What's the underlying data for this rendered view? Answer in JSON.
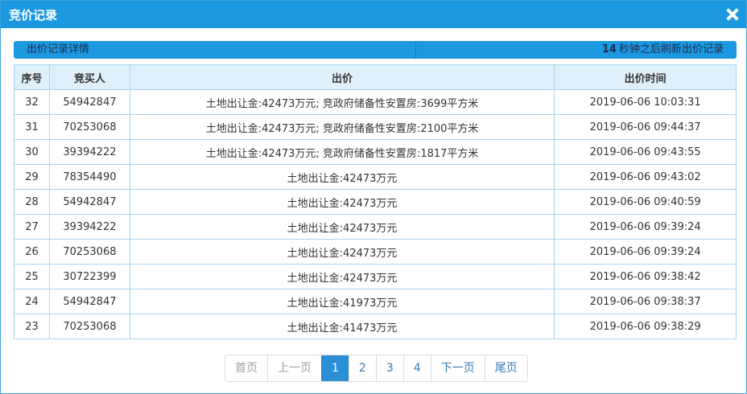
{
  "dialog": {
    "title": "竞价记录"
  },
  "infobar": {
    "left_label": "出价记录详情",
    "refresh_seconds": "14",
    "refresh_suffix": "秒钟之后刷新出价记录"
  },
  "table": {
    "headers": [
      "序号",
      "竞买人",
      "出价",
      "出价时间"
    ],
    "rows": [
      [
        "32",
        "54942847",
        "土地出让金:42473万元; 竞政府储备性安置房:3699平方米",
        "2019-06-06 10:03:31"
      ],
      [
        "31",
        "70253068",
        "土地出让金:42473万元; 竞政府储备性安置房:2100平方米",
        "2019-06-06 09:44:37"
      ],
      [
        "30",
        "39394222",
        "土地出让金:42473万元; 竞政府储备性安置房:1817平方米",
        "2019-06-06 09:43:55"
      ],
      [
        "29",
        "78354490",
        "土地出让金:42473万元",
        "2019-06-06 09:43:02"
      ],
      [
        "28",
        "54942847",
        "土地出让金:42473万元",
        "2019-06-06 09:40:59"
      ],
      [
        "27",
        "39394222",
        "土地出让金:42473万元",
        "2019-06-06 09:39:24"
      ],
      [
        "26",
        "70253068",
        "土地出让金:42473万元",
        "2019-06-06 09:39:24"
      ],
      [
        "25",
        "30722399",
        "土地出让金:42473万元",
        "2019-06-06 09:38:42"
      ],
      [
        "24",
        "54942847",
        "土地出让金:41973万元",
        "2019-06-06 09:38:37"
      ],
      [
        "23",
        "70253068",
        "土地出让金:41473万元",
        "2019-06-06 09:38:29"
      ]
    ]
  },
  "pagination": {
    "first": "首页",
    "prev": "上一页",
    "pages": [
      "1",
      "2",
      "3",
      "4"
    ],
    "current": "1",
    "next": "下一页",
    "last": "尾页"
  },
  "colors": {
    "accent": "#1b98e0",
    "header_bg": "#dff0fb",
    "border": "#a9d4ee",
    "active_page": "#2b8fd6"
  }
}
